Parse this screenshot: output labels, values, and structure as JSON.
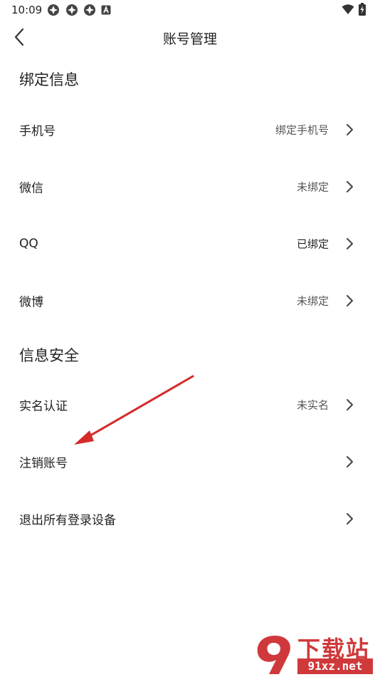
{
  "status_bar": {
    "time": "10:09",
    "notification_icons": [
      "app-notification-icon",
      "app-notification-icon",
      "app-notification-icon",
      "a-badge-icon"
    ],
    "right_icons": [
      "wifi-icon",
      "battery-charging-icon"
    ]
  },
  "header": {
    "title": "账号管理",
    "back_icon": "chevron-left-icon"
  },
  "sections": {
    "binding": {
      "title": "绑定信息",
      "rows": [
        {
          "label": "手机号",
          "value": "绑定手机号"
        },
        {
          "label": "微信",
          "value": "未绑定"
        },
        {
          "label": "QQ",
          "value": "已绑定"
        },
        {
          "label": "微博",
          "value": "未绑定"
        }
      ]
    },
    "security": {
      "title": "信息安全",
      "rows": [
        {
          "label": "实名认证",
          "value": "未实名"
        },
        {
          "label": "注销账号",
          "value": ""
        },
        {
          "label": "退出所有登录设备",
          "value": ""
        }
      ]
    }
  },
  "annotation": {
    "type": "red-arrow",
    "color": "#d42a2a",
    "points_to": "注销账号"
  },
  "watermark": {
    "title": "下载站",
    "domain": "91xz.net",
    "color": "#d0393b"
  },
  "colors": {
    "text_primary": "#222222",
    "text_secondary": "#555555",
    "chevron": "#444444",
    "background": "#ffffff"
  }
}
